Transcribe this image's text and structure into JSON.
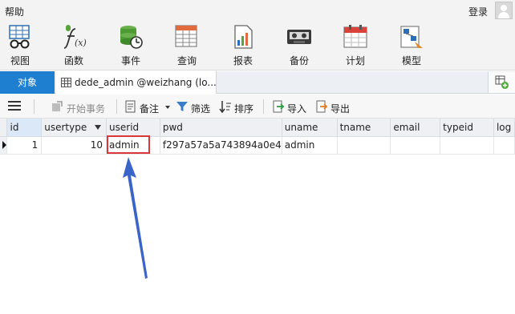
{
  "menu": {
    "help": "帮助",
    "login": "登录"
  },
  "toolbar": [
    {
      "id": "view",
      "label": "视图",
      "icon": "glasses-icon"
    },
    {
      "id": "function",
      "label": "函数",
      "icon": "function-icon"
    },
    {
      "id": "event",
      "label": "事件",
      "icon": "event-clock-icon"
    },
    {
      "id": "query",
      "label": "查询",
      "icon": "query-table-icon"
    },
    {
      "id": "report",
      "label": "报表",
      "icon": "report-chart-icon"
    },
    {
      "id": "backup",
      "label": "备份",
      "icon": "tape-backup-icon"
    },
    {
      "id": "schedule",
      "label": "计划",
      "icon": "calendar-icon"
    },
    {
      "id": "model",
      "label": "模型",
      "icon": "model-icon"
    }
  ],
  "tabs": {
    "objects": "对象",
    "table_tab": "dede_admin @weizhang (lo..."
  },
  "subtoolbar": {
    "begin_transaction": "开始事务",
    "memo": "备注",
    "filter": "筛选",
    "sort": "排序",
    "import": "导入",
    "export": "导出"
  },
  "grid": {
    "columns": [
      "id",
      "usertype",
      "userid",
      "pwd",
      "uname",
      "tname",
      "email",
      "typeid",
      "log"
    ],
    "rows": [
      [
        "1",
        "10",
        "admin",
        "f297a57a5a743894a0e4",
        "admin",
        "",
        "",
        "",
        ""
      ]
    ]
  },
  "colors": {
    "accent": "#1e7fd0",
    "highlight": "#d9373a",
    "arrow": "#3a64c8"
  }
}
